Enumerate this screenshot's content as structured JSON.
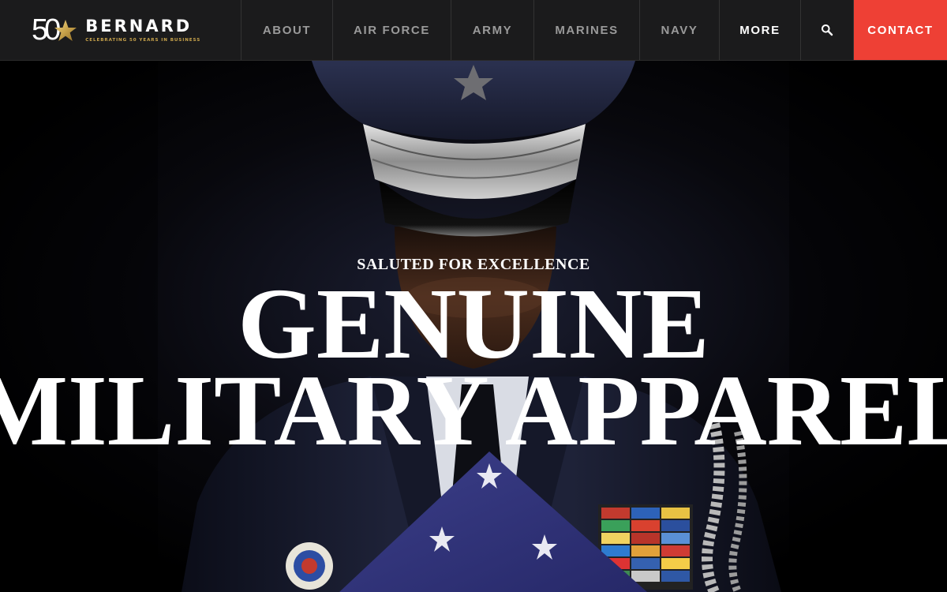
{
  "brand": {
    "logo_number": "50",
    "name": "BERNARD",
    "tagline": "CELEBRATING 50 YEARS IN BUSINESS",
    "accent": "#c9a44c"
  },
  "nav": {
    "items": [
      {
        "label": "ABOUT"
      },
      {
        "label": "AIR FORCE"
      },
      {
        "label": "ARMY"
      },
      {
        "label": "MARINES"
      },
      {
        "label": "NAVY"
      },
      {
        "label": "MORE"
      }
    ],
    "search_icon": "search-icon",
    "contact_label": "CONTACT",
    "contact_color": "#ee4035"
  },
  "hero": {
    "eyebrow": "SALUTED FOR EXCELLENCE",
    "title_line1": "GENUINE",
    "title_line2": "MILITARY APPAREL"
  }
}
